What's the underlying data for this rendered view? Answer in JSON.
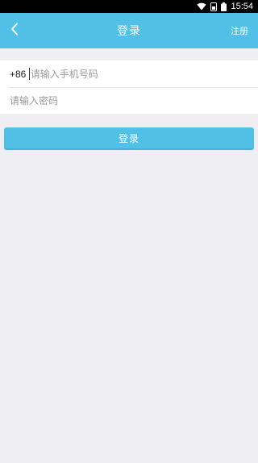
{
  "status_bar": {
    "time": "15:54",
    "icons": [
      "wifi-icon",
      "sim-icon",
      "battery-icon"
    ]
  },
  "header": {
    "title": "登录",
    "back_icon": "chevron-left-icon",
    "register_label": "注册"
  },
  "form": {
    "country_code": "+86",
    "phone_placeholder": "请输入手机号码",
    "password_placeholder": "请输入密码"
  },
  "login_button_label": "登录",
  "colors": {
    "accent": "#51c0e6",
    "background": "#efeef3"
  }
}
